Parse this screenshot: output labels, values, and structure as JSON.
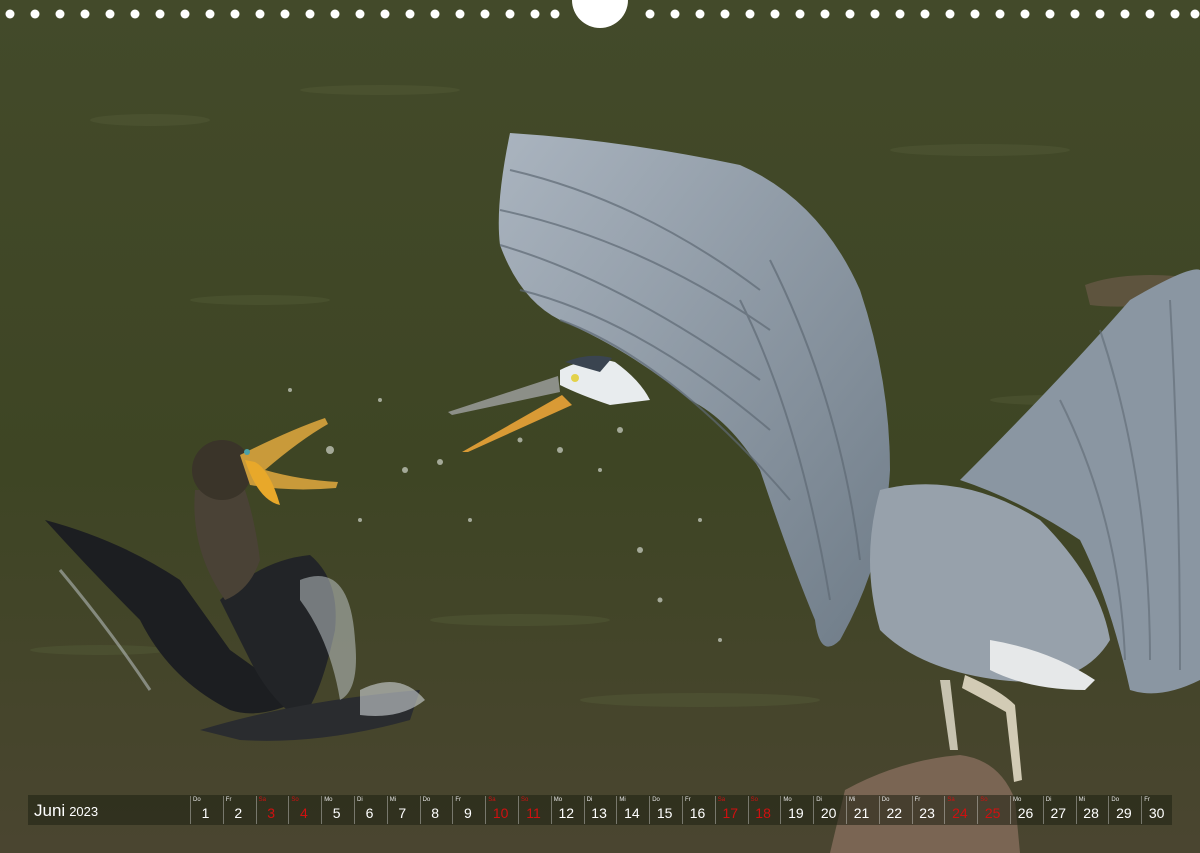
{
  "calendar": {
    "month": "Juni",
    "year": "2023",
    "days": [
      {
        "num": "1",
        "wd": "Do",
        "red": false
      },
      {
        "num": "2",
        "wd": "Fr",
        "red": false
      },
      {
        "num": "3",
        "wd": "Sa",
        "red": true
      },
      {
        "num": "4",
        "wd": "So",
        "red": true
      },
      {
        "num": "5",
        "wd": "Mo",
        "red": false
      },
      {
        "num": "6",
        "wd": "Di",
        "red": false
      },
      {
        "num": "7",
        "wd": "Mi",
        "red": false
      },
      {
        "num": "8",
        "wd": "Do",
        "red": false
      },
      {
        "num": "9",
        "wd": "Fr",
        "red": false
      },
      {
        "num": "10",
        "wd": "Sa",
        "red": true
      },
      {
        "num": "11",
        "wd": "So",
        "red": true
      },
      {
        "num": "12",
        "wd": "Mo",
        "red": false
      },
      {
        "num": "13",
        "wd": "Di",
        "red": false
      },
      {
        "num": "14",
        "wd": "Mi",
        "red": false
      },
      {
        "num": "15",
        "wd": "Do",
        "red": false
      },
      {
        "num": "16",
        "wd": "Fr",
        "red": false
      },
      {
        "num": "17",
        "wd": "Sa",
        "red": true
      },
      {
        "num": "18",
        "wd": "So",
        "red": true
      },
      {
        "num": "19",
        "wd": "Mo",
        "red": false
      },
      {
        "num": "20",
        "wd": "Di",
        "red": false
      },
      {
        "num": "21",
        "wd": "Mi",
        "red": false
      },
      {
        "num": "22",
        "wd": "Do",
        "red": false
      },
      {
        "num": "23",
        "wd": "Fr",
        "red": false
      },
      {
        "num": "24",
        "wd": "Sa",
        "red": true
      },
      {
        "num": "25",
        "wd": "So",
        "red": true
      },
      {
        "num": "26",
        "wd": "Mo",
        "red": false
      },
      {
        "num": "27",
        "wd": "Di",
        "red": false
      },
      {
        "num": "28",
        "wd": "Mi",
        "red": false
      },
      {
        "num": "29",
        "wd": "Do",
        "red": false
      },
      {
        "num": "30",
        "wd": "Fr",
        "red": false
      }
    ]
  },
  "colors": {
    "water": "#3d4424",
    "heron": "#8f9aa4",
    "cormorant": "#1f2124",
    "beak": "#e8a82a",
    "holiday": "#d01010"
  }
}
